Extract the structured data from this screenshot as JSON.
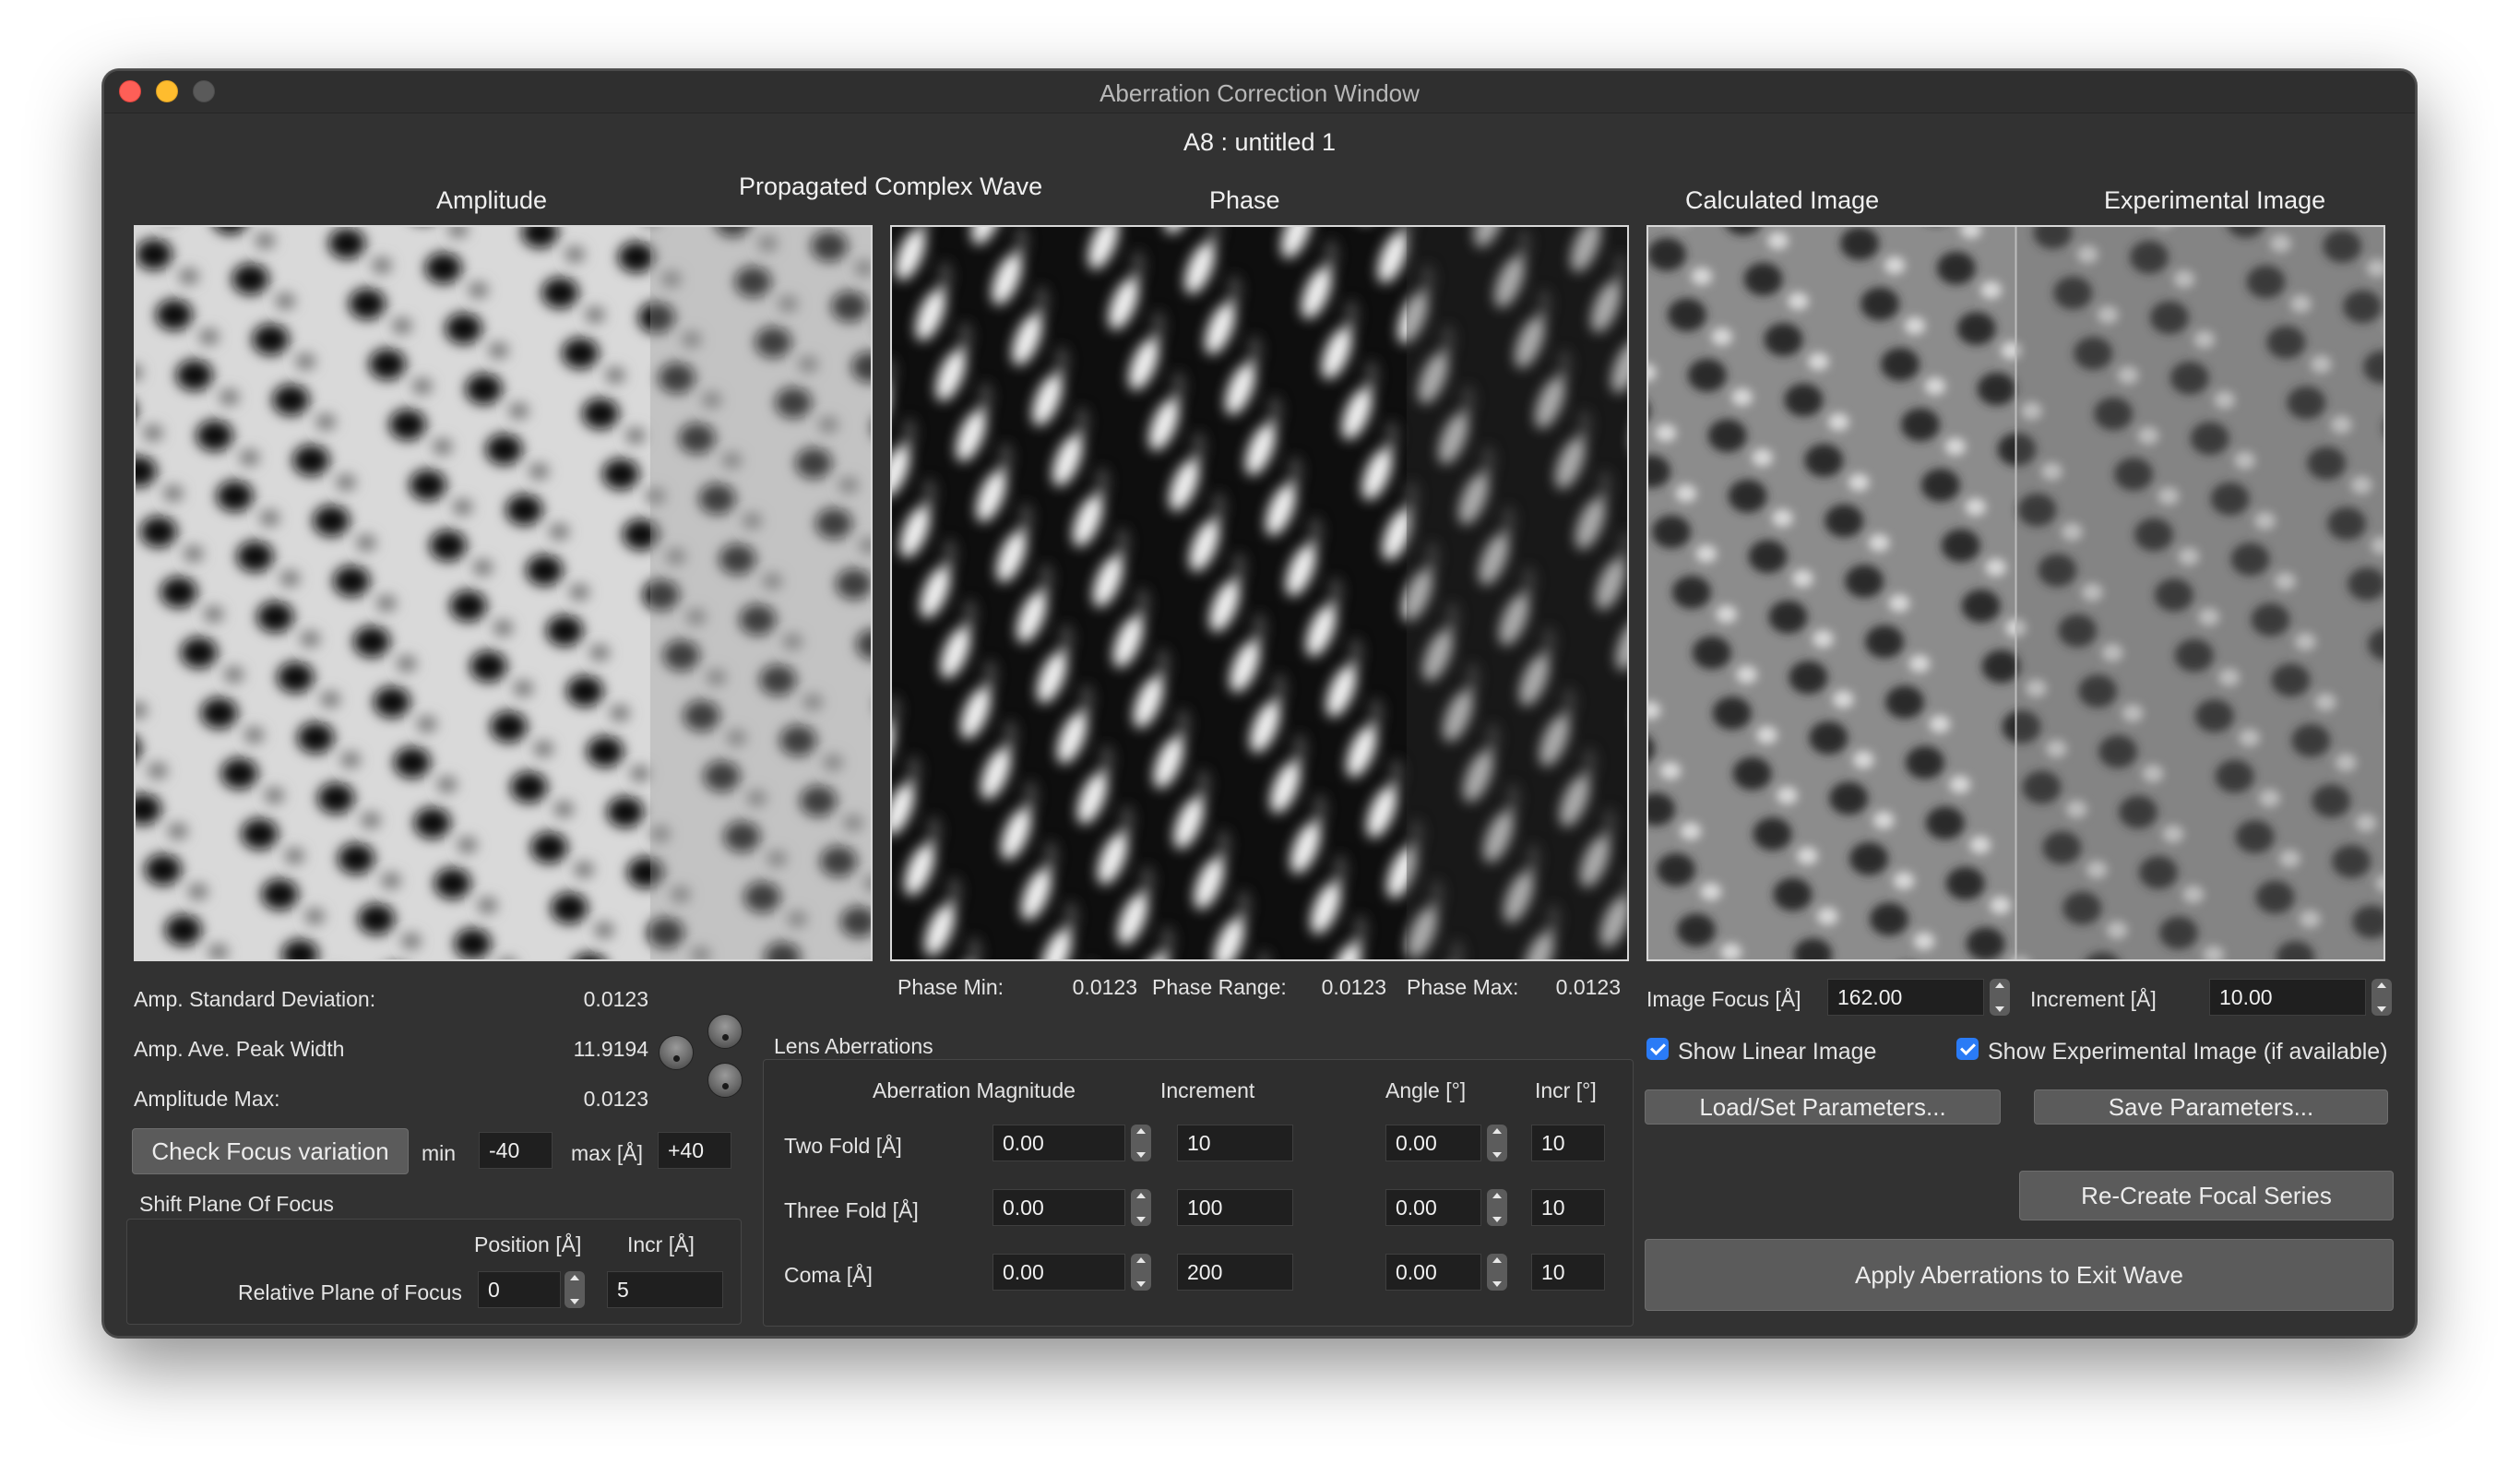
{
  "window": {
    "title": "Aberration Correction Window",
    "subtitle": "A8 : untitled 1"
  },
  "panels": {
    "propagated_complex_wave": "Propagated Complex Wave",
    "amplitude_title": "Amplitude",
    "phase_title": "Phase",
    "calculated_title": "Calculated Image",
    "experimental_title": "Experimental Image"
  },
  "amplitude_stats": {
    "std_label": "Amp. Standard Deviation:",
    "std_value": "0.0123",
    "peak_label": "Amp. Ave. Peak Width",
    "peak_value": "11.9194",
    "max_label": "Amplitude Max:",
    "max_value": "0.0123"
  },
  "phase_stats": {
    "min_label": "Phase Min:",
    "min_value": "0.0123",
    "range_label": "Phase Range:",
    "range_value": "0.0123",
    "max_label": "Phase Max:",
    "max_value": "0.0123"
  },
  "focus_variation": {
    "button": "Check Focus variation",
    "min_label": "min",
    "min_value": "-40",
    "max_label": "max [Å]",
    "max_value": "+40"
  },
  "shift_plane": {
    "title": "Shift Plane Of Focus",
    "position_header": "Position [Å]",
    "incr_header": "Incr [Å]",
    "row_label": "Relative Plane of Focus",
    "position_value": "0",
    "incr_value": "5"
  },
  "lens_aberrations": {
    "title": "Lens Aberrations",
    "headers": {
      "magnitude": "Aberration Magnitude",
      "increment": "Increment",
      "angle": "Angle [°]",
      "incr": "Incr [°]"
    },
    "rows": [
      {
        "label": "Two Fold  [Å]",
        "magnitude": "0.00",
        "increment": "10",
        "angle": "0.00",
        "incr": "10"
      },
      {
        "label": "Three Fold [Å]",
        "magnitude": "0.00",
        "increment": "100",
        "angle": "0.00",
        "incr": "10"
      },
      {
        "label": "Coma [Å]",
        "magnitude": "0.00",
        "increment": "200",
        "angle": "0.00",
        "incr": "10"
      }
    ]
  },
  "image_controls": {
    "focus_label": "Image Focus [Å]",
    "focus_value": "162.00",
    "increment_label": "Increment [Å]",
    "increment_value": "10.00",
    "show_linear": "Show Linear Image",
    "show_experimental": "Show Experimental Image (if available)",
    "load_button": "Load/Set Parameters...",
    "save_button": "Save Parameters...",
    "recreate_button": "Re-Create Focal Series",
    "apply_button": "Apply Aberrations to Exit Wave"
  }
}
